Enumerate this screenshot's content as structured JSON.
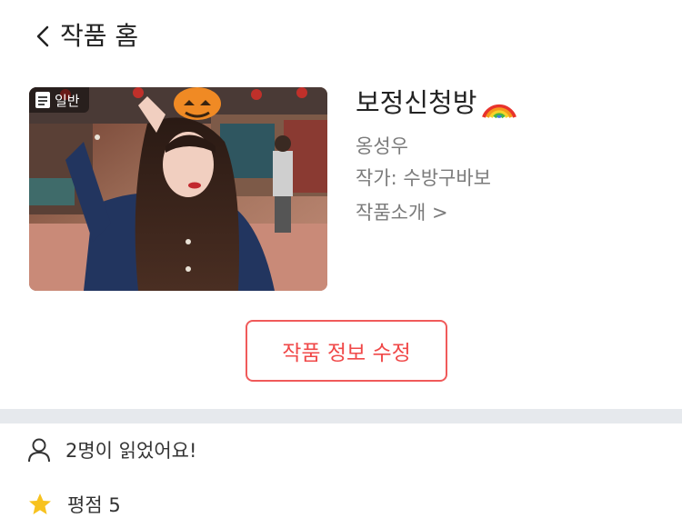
{
  "header": {
    "title": "작품 홈",
    "back_icon": "chevron-left-icon"
  },
  "work": {
    "badge_label": "일반",
    "badge_icon": "document-icon",
    "title": "보정신청방",
    "title_emoji_icon": "rainbow-icon",
    "author": "옹성우",
    "writer": "작가: 수방구바보",
    "intro_link": "작품소개 >"
  },
  "actions": {
    "edit_label": "작품 정보 수정"
  },
  "stats": {
    "readers": "2명이 읽었어요!",
    "readers_icon": "user-icon",
    "rating": "평점 5",
    "rating_icon": "star-icon"
  },
  "colors": {
    "accent": "#f04848",
    "muted_text": "#7b7b7b",
    "divider": "#e6e9ed",
    "star": "#f7c21f"
  }
}
